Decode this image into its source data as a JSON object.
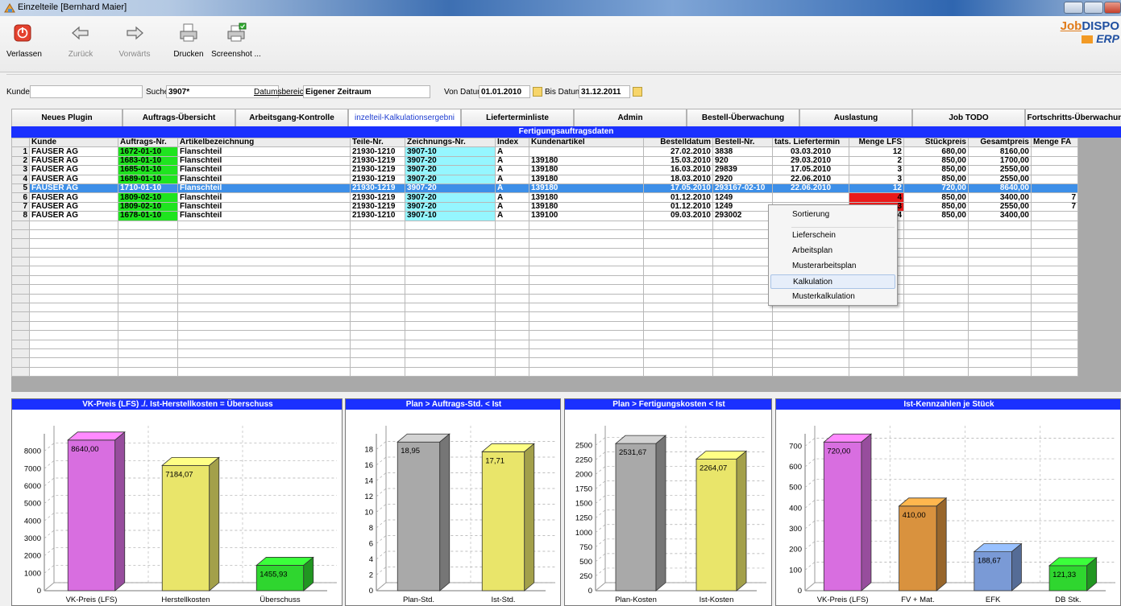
{
  "window": {
    "title": "Einzelteile  [Bernhard Maier]"
  },
  "toolbar": {
    "buttons": [
      {
        "label": "Verlassen",
        "icon": "power-icon"
      },
      {
        "label": "Zurück",
        "icon": "arrow-left-icon"
      },
      {
        "label": "Vorwärts",
        "icon": "arrow-right-icon"
      },
      {
        "label": "Drucken",
        "icon": "printer-icon"
      },
      {
        "label": "Screenshot ...",
        "icon": "screenshot-printer-icon"
      }
    ],
    "logo": {
      "line1_a": "Job",
      "line1_b": "DISPO",
      "line2": "ERP"
    }
  },
  "filter": {
    "kunde_label": "Kunde",
    "kunde_value": "",
    "suche_label": "Suche",
    "suche_value": "3907*",
    "datumsbereich_label": "Datumsbereich",
    "datumsbereich_value": "Eigener Zeitraum",
    "von_label": "Von Datum",
    "von_value": "01.01.2010",
    "bis_label": "Bis Datum",
    "bis_value": "31.12.2011"
  },
  "tabs": [
    "Neues Plugin",
    "Auftrags-Übersicht",
    "Arbeitsgang-Kontrolle",
    "inzelteil-Kalkulationsergebni",
    "Lieferterminliste",
    "Admin",
    "Bestell-Überwachung",
    "Auslastung",
    "Job TODO",
    "Fortschritts-Überwachung"
  ],
  "grid": {
    "title": "Fertigungsauftragsdaten",
    "columns": [
      "Kunde",
      "Auftrags-Nr.",
      "Artikelbezeichnung",
      "Teile-Nr.",
      "Zeichnungs-Nr.",
      "Index",
      "Kundenartikel",
      "Bestelldatum",
      "Bestell-Nr.",
      "tats. Liefertermin",
      "Menge LFS",
      "Stückpreis",
      "Gesamtpreis",
      "Menge FA"
    ],
    "rows": [
      {
        "n": "1",
        "kunde": "FAUSER AG",
        "auftrag": "1672-01-10",
        "artikel": "Flanschteil",
        "teile": "21930-1210",
        "zeichnung": "3907-10",
        "index": "A",
        "kundenartikel": "",
        "bestelldatum": "27.02.2010",
        "bestellnr": "3838",
        "liefertermin": "03.03.2010",
        "menge_lfs": "12",
        "stueckpreis": "680,00",
        "gesamtpreis": "8160,00",
        "menge_fa": ""
      },
      {
        "n": "2",
        "kunde": "FAUSER AG",
        "auftrag": "1683-01-10",
        "artikel": "Flanschteil",
        "teile": "21930-1219",
        "zeichnung": "3907-20",
        "index": "A",
        "kundenartikel": "139180",
        "bestelldatum": "15.03.2010",
        "bestellnr": "920",
        "liefertermin": "29.03.2010",
        "menge_lfs": "2",
        "stueckpreis": "850,00",
        "gesamtpreis": "1700,00",
        "menge_fa": ""
      },
      {
        "n": "3",
        "kunde": "FAUSER AG",
        "auftrag": "1685-01-10",
        "artikel": "Flanschteil",
        "teile": "21930-1219",
        "zeichnung": "3907-20",
        "index": "A",
        "kundenartikel": "139180",
        "bestelldatum": "16.03.2010",
        "bestellnr": "29839",
        "liefertermin": "17.05.2010",
        "menge_lfs": "3",
        "stueckpreis": "850,00",
        "gesamtpreis": "2550,00",
        "menge_fa": ""
      },
      {
        "n": "4",
        "kunde": "FAUSER AG",
        "auftrag": "1689-01-10",
        "artikel": "Flanschteil",
        "teile": "21930-1219",
        "zeichnung": "3907-20",
        "index": "A",
        "kundenartikel": "139180",
        "bestelldatum": "18.03.2010",
        "bestellnr": "2920",
        "liefertermin": "22.06.2010",
        "menge_lfs": "3",
        "stueckpreis": "850,00",
        "gesamtpreis": "2550,00",
        "menge_fa": ""
      },
      {
        "n": "5",
        "kunde": "FAUSER AG",
        "auftrag": "1710-01-10",
        "artikel": "Flanschteil",
        "teile": "21930-1219",
        "zeichnung": "3907-20",
        "index": "A",
        "kundenartikel": "139180",
        "bestelldatum": "17.05.2010",
        "bestellnr": "293167-02-10",
        "liefertermin": "22.06.2010",
        "menge_lfs": "12",
        "stueckpreis": "720,00",
        "gesamtpreis": "8640,00",
        "menge_fa": ""
      },
      {
        "n": "6",
        "kunde": "FAUSER AG",
        "auftrag": "1809-02-10",
        "artikel": "Flanschteil",
        "teile": "21930-1219",
        "zeichnung": "3907-20",
        "index": "A",
        "kundenartikel": "139180",
        "bestelldatum": "01.12.2010",
        "bestellnr": "1249",
        "liefertermin": "",
        "menge_lfs": "4",
        "stueckpreis": "850,00",
        "gesamtpreis": "3400,00",
        "menge_fa": "7"
      },
      {
        "n": "7",
        "kunde": "FAUSER AG",
        "auftrag": "1809-02-10",
        "artikel": "Flanschteil",
        "teile": "21930-1219",
        "zeichnung": "3907-20",
        "index": "A",
        "kundenartikel": "139180",
        "bestelldatum": "01.12.2010",
        "bestellnr": "1249",
        "liefertermin": "",
        "menge_lfs": "3",
        "stueckpreis": "850,00",
        "gesamtpreis": "2550,00",
        "menge_fa": "7"
      },
      {
        "n": "8",
        "kunde": "FAUSER AG",
        "auftrag": "1678-01-10",
        "artikel": "Flanschteil",
        "teile": "21930-1210",
        "zeichnung": "3907-10",
        "index": "A",
        "kundenartikel": "139100",
        "bestelldatum": "09.03.2010",
        "bestellnr": "293002",
        "liefertermin": "",
        "menge_lfs": "4",
        "stueckpreis": "850,00",
        "gesamtpreis": "3400,00",
        "menge_fa": ""
      }
    ],
    "selected_row": 5,
    "blank_rows": 17
  },
  "context_menu": {
    "items": [
      "Sortierung",
      "Lieferschein",
      "Arbeitsplan",
      "Musterarbeitsplan",
      "Kalkulation",
      "Musterkalkulation"
    ],
    "highlighted": "Kalkulation"
  },
  "chart_data": [
    {
      "type": "bar",
      "title": "VK-Preis (LFS) ./. Ist-Herstellkosten = Überschuss",
      "categories": [
        "VK-Preis (LFS)",
        "Herstellkosten",
        "Überschuss"
      ],
      "values": [
        8640.0,
        7184.07,
        1455.93
      ],
      "value_labels": [
        "8640,00",
        "7184,07",
        "1455,93"
      ],
      "colors": [
        "#d86ee0",
        "#e9e56a",
        "#2fd62f"
      ],
      "ylim": [
        0,
        9000
      ],
      "yticks": [
        0,
        1000,
        2000,
        3000,
        4000,
        5000,
        6000,
        7000,
        8000
      ],
      "grid": true
    },
    {
      "type": "bar",
      "title": "Plan > Auftrags-Std. < Ist",
      "categories": [
        "Plan-Std.",
        "Ist-Std."
      ],
      "values": [
        18.95,
        17.71
      ],
      "value_labels": [
        "18,95",
        "17,71"
      ],
      "colors": [
        "#a9a9a9",
        "#e9e56a"
      ],
      "ylim": [
        0,
        20
      ],
      "yticks": [
        0,
        2,
        4,
        6,
        8,
        10,
        12,
        14,
        16,
        18
      ],
      "grid": true
    },
    {
      "type": "bar",
      "title": "Plan > Fertigungskosten < Ist",
      "categories": [
        "Plan-Kosten",
        "Ist-Kosten"
      ],
      "values": [
        2531.67,
        2264.07
      ],
      "value_labels": [
        "2531,67",
        "2264,07"
      ],
      "colors": [
        "#a9a9a9",
        "#e9e56a"
      ],
      "ylim": [
        0,
        2700
      ],
      "yticks": [
        0,
        250,
        500,
        750,
        1000,
        1250,
        1500,
        1750,
        2000,
        2250,
        2500
      ],
      "grid": true
    },
    {
      "type": "bar",
      "title": "Ist-Kennzahlen je Stück",
      "categories": [
        "VK-Preis (LFS)",
        "FV + Mat.",
        "EFK",
        "DB Stk."
      ],
      "values": [
        720.0,
        410.0,
        188.67,
        121.33
      ],
      "value_labels": [
        "720,00",
        "410,00",
        "188,67",
        "121,33"
      ],
      "colors": [
        "#d86ee0",
        "#d9923e",
        "#7a9ad6",
        "#2fd62f"
      ],
      "ylim": [
        0,
        760
      ],
      "yticks": [
        0,
        100,
        200,
        300,
        400,
        500,
        600,
        700
      ],
      "grid": true
    }
  ]
}
